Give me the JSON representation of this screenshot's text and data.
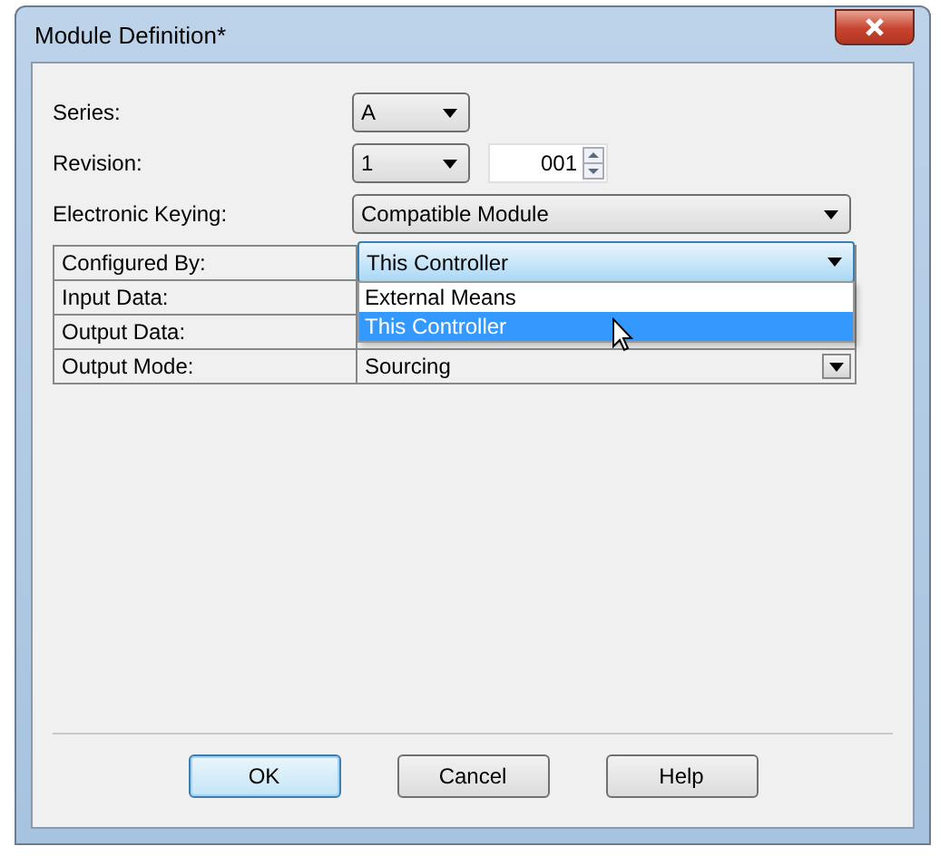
{
  "window": {
    "title": "Module Definition*"
  },
  "series": {
    "label": "Series:",
    "value": "A"
  },
  "revision": {
    "label": "Revision:",
    "major": "1",
    "minor": "001"
  },
  "electronic_keying": {
    "label": "Electronic Keying:",
    "value": "Compatible Module"
  },
  "table": {
    "rows": [
      {
        "label": "Configured By:",
        "value": "This Controller",
        "kind": "dropdown",
        "expanded": true,
        "options": [
          {
            "label": "External Means",
            "selected": false
          },
          {
            "label": "This Controller",
            "selected": true
          }
        ]
      },
      {
        "label": "Input Data:",
        "kind": "text"
      },
      {
        "label": "Output Data:",
        "kind": "text"
      },
      {
        "label": "Output Mode:",
        "value": "Sourcing",
        "kind": "combo"
      }
    ]
  },
  "buttons": [
    {
      "label": "OK",
      "focused": true
    },
    {
      "label": "Cancel",
      "focused": false
    },
    {
      "label": "Help",
      "focused": false
    }
  ]
}
